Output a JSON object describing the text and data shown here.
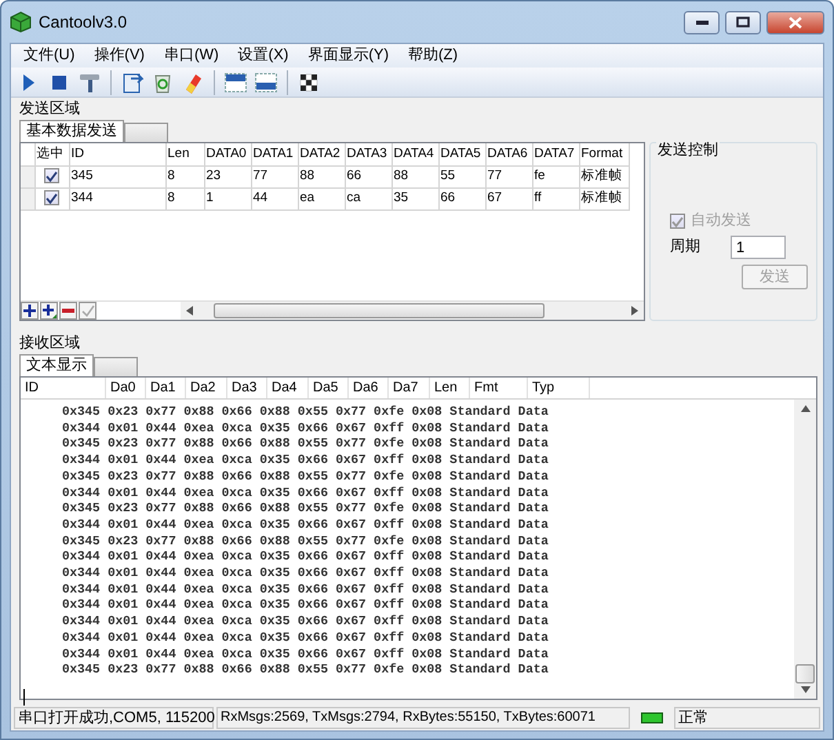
{
  "window": {
    "title": "Cantoolv3.0"
  },
  "menu": [
    "文件(U)",
    "操作(V)",
    "串口(W)",
    "设置(X)",
    "界面显示(Y)",
    "帮助(Z)"
  ],
  "send_area": {
    "label": "发送区域",
    "tabs": [
      {
        "label": "基本数据发送",
        "selected": true
      },
      {
        "selected": false
      }
    ],
    "columns": [
      "选中",
      "ID",
      "Len",
      "DATA0",
      "DATA1",
      "DATA2",
      "DATA3",
      "DATA4",
      "DATA5",
      "DATA6",
      "DATA7",
      "Format"
    ],
    "rows": [
      {
        "checked": true,
        "cells": [
          "",
          "345",
          "8",
          "23",
          "77",
          "88",
          "66",
          "88",
          "55",
          "77",
          "fe",
          "标准帧"
        ]
      },
      {
        "checked": true,
        "cells": [
          "",
          "344",
          "8",
          "1",
          "44",
          "ea",
          "ca",
          "35",
          "66",
          "67",
          "ff",
          "标准帧"
        ]
      }
    ],
    "control": {
      "title": "发送控制",
      "auto_send": {
        "label": "自动发送",
        "checked": true,
        "disabled": true
      },
      "period": {
        "label": "周期",
        "value": "1"
      },
      "send_button": {
        "label": "发送",
        "disabled": true
      }
    }
  },
  "receive_area": {
    "label": "接收区域",
    "tabs": [
      {
        "label": "文本显示",
        "selected": true
      },
      {
        "selected": false
      }
    ],
    "columns": [
      "ID",
      "Da0",
      "Da1",
      "Da2",
      "Da3",
      "Da4",
      "Da5",
      "Da6",
      "Da7",
      "Len",
      "Fmt",
      "Typ"
    ],
    "lines": [
      "0x345 0x23 0x77 0x88 0x66 0x88 0x55 0x77 0xfe 0x08 Standard Data",
      "0x344 0x01 0x44 0xea 0xca 0x35 0x66 0x67 0xff 0x08 Standard Data",
      "0x345 0x23 0x77 0x88 0x66 0x88 0x55 0x77 0xfe 0x08 Standard Data",
      "0x344 0x01 0x44 0xea 0xca 0x35 0x66 0x67 0xff 0x08 Standard Data",
      "0x345 0x23 0x77 0x88 0x66 0x88 0x55 0x77 0xfe 0x08 Standard Data",
      "0x344 0x01 0x44 0xea 0xca 0x35 0x66 0x67 0xff 0x08 Standard Data",
      "0x345 0x23 0x77 0x88 0x66 0x88 0x55 0x77 0xfe 0x08 Standard Data",
      "0x344 0x01 0x44 0xea 0xca 0x35 0x66 0x67 0xff 0x08 Standard Data",
      "0x345 0x23 0x77 0x88 0x66 0x88 0x55 0x77 0xfe 0x08 Standard Data",
      "0x344 0x01 0x44 0xea 0xca 0x35 0x66 0x67 0xff 0x08 Standard Data",
      "0x344 0x01 0x44 0xea 0xca 0x35 0x66 0x67 0xff 0x08 Standard Data",
      "0x344 0x01 0x44 0xea 0xca 0x35 0x66 0x67 0xff 0x08 Standard Data",
      "0x344 0x01 0x44 0xea 0xca 0x35 0x66 0x67 0xff 0x08 Standard Data",
      "0x344 0x01 0x44 0xea 0xca 0x35 0x66 0x67 0xff 0x08 Standard Data",
      "0x344 0x01 0x44 0xea 0xca 0x35 0x66 0x67 0xff 0x08 Standard Data",
      "0x344 0x01 0x44 0xea 0xca 0x35 0x66 0x67 0xff 0x08 Standard Data",
      "0x345 0x23 0x77 0x88 0x66 0x88 0x55 0x77 0xfe 0x08 Standard Data"
    ]
  },
  "status_bar": {
    "port": "串口打开成功,COM5, 115200",
    "stats": "RxMsgs:2569, TxMsgs:2794, RxBytes:55150, TxBytes:60071",
    "state": "正常"
  }
}
